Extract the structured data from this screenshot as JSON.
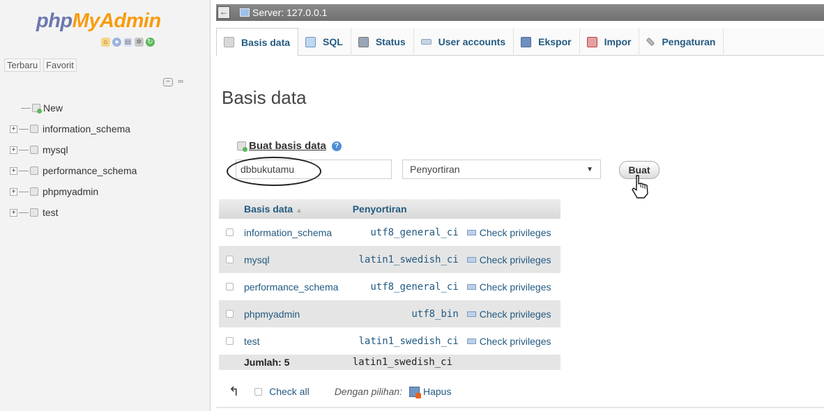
{
  "logo": {
    "part1": "php",
    "part2": "MyAdmin"
  },
  "nav": {
    "recent_tabs": [
      "Terbaru",
      "Favorit"
    ],
    "tree": [
      {
        "label": "New",
        "type": "new"
      },
      {
        "label": "information_schema",
        "type": "db"
      },
      {
        "label": "mysql",
        "type": "db"
      },
      {
        "label": "performance_schema",
        "type": "db"
      },
      {
        "label": "phpmyadmin",
        "type": "db"
      },
      {
        "label": "test",
        "type": "db"
      }
    ]
  },
  "serverbar": {
    "label": "Server: 127.0.0.1"
  },
  "tabs": [
    {
      "label": "Basis data",
      "icon": "database-icon",
      "active": true
    },
    {
      "label": "SQL",
      "icon": "sql-icon"
    },
    {
      "label": "Status",
      "icon": "status-icon"
    },
    {
      "label": "User accounts",
      "icon": "users-icon"
    },
    {
      "label": "Ekspor",
      "icon": "export-icon"
    },
    {
      "label": "Impor",
      "icon": "import-icon"
    },
    {
      "label": "Pengaturan",
      "icon": "settings-icon"
    }
  ],
  "main": {
    "title": "Basis data",
    "create_label": "Buat basis data",
    "db_name_value": "dbbukutamu",
    "collation_selected": "Penyortiran",
    "create_button": "Buat"
  },
  "table": {
    "headers": {
      "database": "Basis data",
      "collation": "Penyortiran"
    },
    "rows": [
      {
        "name": "information_schema",
        "collation": "utf8_general_ci",
        "action": "Check privileges"
      },
      {
        "name": "mysql",
        "collation": "latin1_swedish_ci",
        "action": "Check privileges"
      },
      {
        "name": "performance_schema",
        "collation": "utf8_general_ci",
        "action": "Check privileges"
      },
      {
        "name": "phpmyadmin",
        "collation": "utf8_bin",
        "action": "Check privileges"
      },
      {
        "name": "test",
        "collation": "latin1_swedish_ci",
        "action": "Check privileges"
      }
    ],
    "total": {
      "label": "Jumlah: 5",
      "collation": "latin1_swedish_ci"
    }
  },
  "bottom": {
    "check_all": "Check all",
    "with_selected": "Dengan pilihan:",
    "delete": "Hapus"
  },
  "colors": {
    "link": "#235a81",
    "logo_php": "#6c78af",
    "logo_myadmin": "#f89c0e",
    "serverbar": "#7a7a7a",
    "row_alt": "#e5e5e5"
  }
}
